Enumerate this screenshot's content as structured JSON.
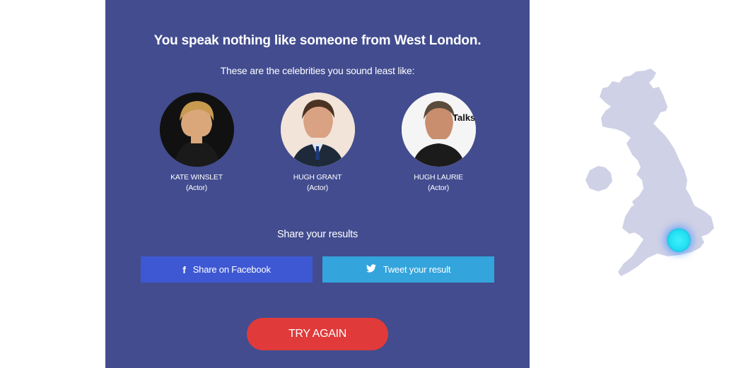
{
  "result": {
    "headline": "You speak nothing like someone from West London.",
    "subhead": "These are the celebrities you sound least like:"
  },
  "celebrities": [
    {
      "name": "KATE WINSLET",
      "role": "(Actor)"
    },
    {
      "name": "HUGH GRANT",
      "role": "(Actor)"
    },
    {
      "name": "HUGH LAURIE",
      "role": "(Actor)"
    }
  ],
  "share": {
    "title": "Share your results",
    "facebook_label": "Share on Facebook",
    "twitter_label": "Tweet your result"
  },
  "try_again_label": "TRY AGAIN",
  "colors": {
    "panel": "#424c8f",
    "facebook": "#3e58d3",
    "twitter": "#34a4dc",
    "try_again": "#e03a3a",
    "map": "#cfd1e6",
    "marker": "#2ee6f2"
  },
  "icons": {
    "facebook": "facebook-icon",
    "twitter": "twitter-icon",
    "map": "uk-map-icon",
    "marker": "location-marker-icon"
  }
}
